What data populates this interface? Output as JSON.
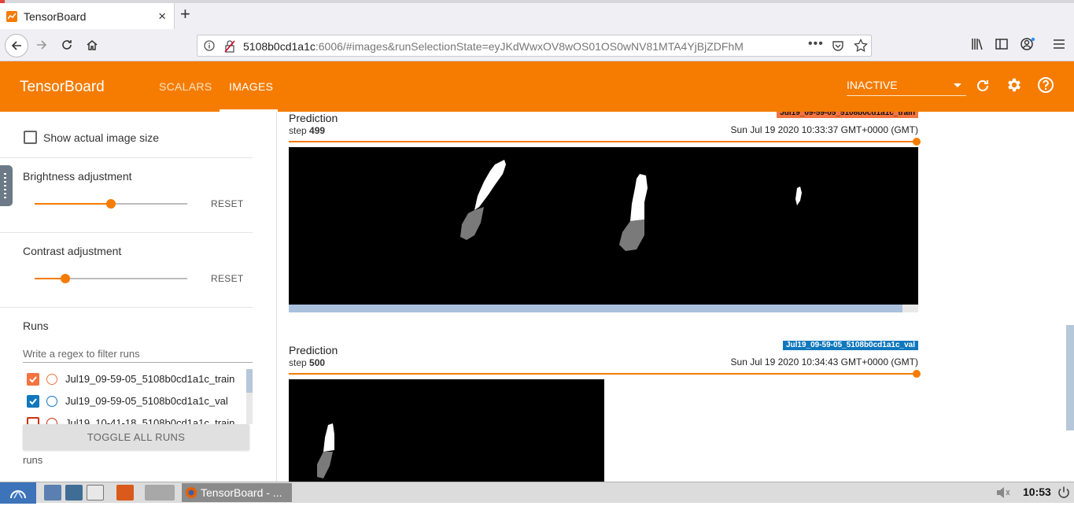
{
  "browser": {
    "tab_title": "TensorBoard",
    "new_tab_icon": "+",
    "close_tab_icon": "×",
    "url_host": "5108b0cd1a1c",
    "url_rest": ":6006/#images&runSelectionState=eyJKdWwxOV8wOS01OS0wNV81MTA4YjBjZDFhM",
    "url_more": "•••"
  },
  "header": {
    "brand": "TensorBoard",
    "tabs": [
      {
        "label": "SCALARS",
        "active": false
      },
      {
        "label": "IMAGES",
        "active": true
      }
    ],
    "status_select": "INACTIVE",
    "accent_color": "#f57c00"
  },
  "sidebar": {
    "show_actual_size_label": "Show actual image size",
    "brightness": {
      "title": "Brightness adjustment",
      "reset": "RESET",
      "value_fraction": 0.5
    },
    "contrast": {
      "title": "Contrast adjustment",
      "reset": "RESET",
      "value_fraction": 0.2
    },
    "runs_title": "Runs",
    "filter_placeholder": "Write a regex to filter runs",
    "runs": [
      {
        "name": "Jul19_09-59-05_5108b0cd1a1c_train",
        "checked": true,
        "color": "#f4733f"
      },
      {
        "name": "Jul19_09-59-05_5108b0cd1a1c_val",
        "checked": true,
        "color": "#0f77bd"
      },
      {
        "name": "Jul19_10-41-18_5108b0cd1a1c_train",
        "checked": false,
        "color": "#cc3311"
      }
    ],
    "toggle_all": "TOGGLE ALL RUNS",
    "footer": "runs"
  },
  "cards": [
    {
      "title": "Prediction",
      "step_label": "step",
      "step": "499",
      "run_badge": "Jul19_09-59-05_5108b0cd1a1c_train",
      "badge_color": "#f4733f",
      "timestamp": "Sun Jul 19 2020 10:33:37 GMT+0000 (GMT)"
    },
    {
      "title": "Prediction",
      "step_label": "step",
      "step": "500",
      "run_badge": "Jul19_09-59-05_5108b0cd1a1c_val",
      "badge_color": "#0f77bd",
      "timestamp": "Sun Jul 19 2020 10:34:43 GMT+0000 (GMT)"
    }
  ],
  "taskbar": {
    "task_label": "TensorBoard - ...",
    "clock": "10:53"
  }
}
